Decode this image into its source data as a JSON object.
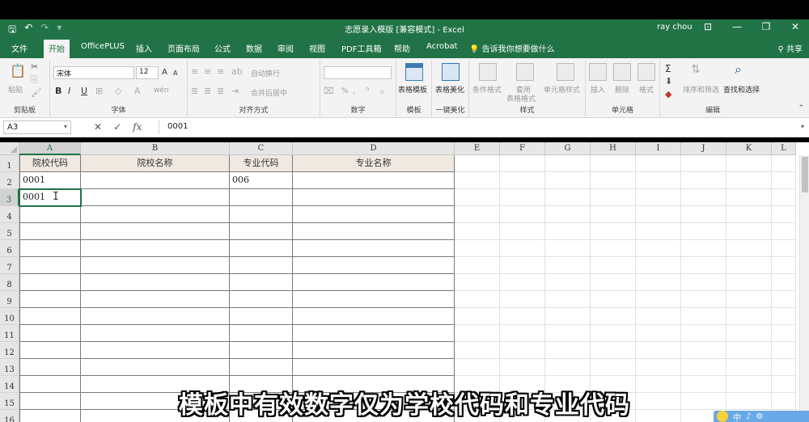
{
  "window": {
    "title": "志愿录入模版 [兼容模式] - Excel",
    "user": "ray chou",
    "buttons": [
      "—",
      "❐",
      "✕"
    ]
  },
  "qat": {
    "save_icon": "save-icon",
    "undo": "↶",
    "redo": "↷",
    "more": "▾"
  },
  "tabs": [
    "文件",
    "开始",
    "OfficePLUS",
    "插入",
    "页面布局",
    "公式",
    "数据",
    "审阅",
    "视图",
    "PDF工具箱",
    "帮助",
    "Acrobat"
  ],
  "active_tab": "开始",
  "tell_me": "告诉我你想要做什么",
  "share": "共享",
  "ribbon": {
    "clipboard": {
      "label": "剪贴板",
      "paste": "粘贴"
    },
    "font": {
      "label": "字体",
      "font_name": "宋体",
      "font_size": "12",
      "inc": "A",
      "dec": "A",
      "bold": "B",
      "italic": "I",
      "underline": "U",
      "wen": "wén"
    },
    "alignment": {
      "label": "对齐方式",
      "wrap": "自动换行",
      "merge": "合并后居中"
    },
    "number": {
      "label": "数字",
      "format_value": "",
      "percent": "%",
      "comma": ","
    },
    "template": {
      "label": "模板",
      "table_template": "表格模板"
    },
    "beautify": {
      "label": "一键美化",
      "table_beautify": "表格美化"
    },
    "styles": {
      "label": "样式",
      "cond_format": "条件格式",
      "apply": "套用",
      "table_fmt": "表格格式",
      "cell_styles": "单元格样式"
    },
    "cells": {
      "label": "单元格",
      "insert": "插入",
      "delete": "删除",
      "format": "格式"
    },
    "editing": {
      "label": "编辑",
      "sort_filter": "排序和筛选",
      "find_select": "查找和选择",
      "sigma": "Σ"
    }
  },
  "formula_bar": {
    "name_box": "A3",
    "cancel": "✕",
    "enter": "✓",
    "fx": "fx",
    "value": "0001"
  },
  "columns": [
    "A",
    "B",
    "C",
    "D",
    "E",
    "F",
    "G",
    "H",
    "I",
    "J",
    "K",
    "L"
  ],
  "rows": [
    "1",
    "2",
    "3",
    "4",
    "5",
    "6",
    "7",
    "8",
    "9",
    "10",
    "11",
    "12",
    "13",
    "14",
    "15",
    "16"
  ],
  "table": {
    "headers": [
      "院校代码",
      "院校名称",
      "专业代码",
      "专业名称"
    ],
    "row2": [
      "0001",
      "",
      "006",
      ""
    ],
    "row3": [
      "0001",
      "",
      "",
      ""
    ]
  },
  "subtitle": "模板中有效数字仅为学校代码和专业代码",
  "ime": {
    "lang": "中"
  }
}
